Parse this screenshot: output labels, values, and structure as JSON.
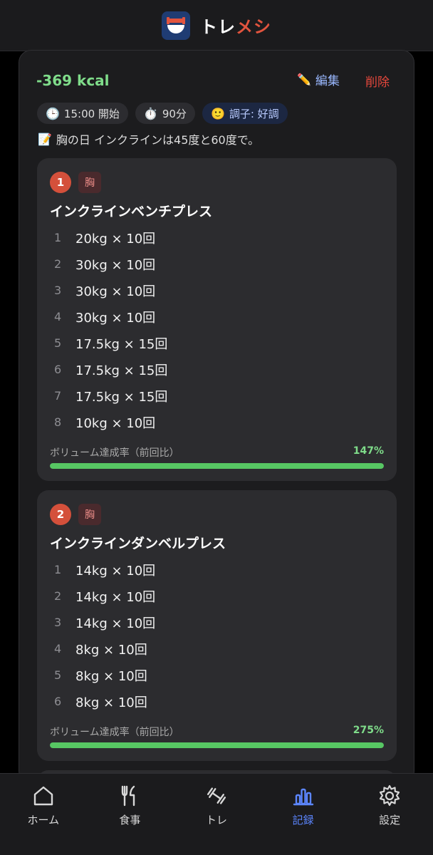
{
  "header": {
    "title_part1": "トレ",
    "title_part2": "メシ",
    "logo_icon": "dumbbell-bowl-icon"
  },
  "record": {
    "kcal": "-369 kcal",
    "edit_label": "編集",
    "delete_label": "削除",
    "chips": {
      "start": "15:00 開始",
      "duration": "90分",
      "condition": "調子: 好調"
    },
    "memo": "胸の日 インクラインは45度と60度で。"
  },
  "exercises": [
    {
      "index": "1",
      "part": "胸",
      "name": "インクラインベンチプレス",
      "sets": [
        {
          "no": "1",
          "value": "20kg × 10回"
        },
        {
          "no": "2",
          "value": "30kg × 10回"
        },
        {
          "no": "3",
          "value": "30kg × 10回"
        },
        {
          "no": "4",
          "value": "30kg × 10回"
        },
        {
          "no": "5",
          "value": "17.5kg × 15回"
        },
        {
          "no": "6",
          "value": "17.5kg × 15回"
        },
        {
          "no": "7",
          "value": "17.5kg × 15回"
        },
        {
          "no": "8",
          "value": "10kg × 10回"
        }
      ],
      "volume_label": "ボリューム達成率（前回比）",
      "volume_pct": "147%",
      "volume_fill": 1.0
    },
    {
      "index": "2",
      "part": "胸",
      "name": "インクラインダンベルプレス",
      "sets": [
        {
          "no": "1",
          "value": "14kg × 10回"
        },
        {
          "no": "2",
          "value": "14kg × 10回"
        },
        {
          "no": "3",
          "value": "14kg × 10回"
        },
        {
          "no": "4",
          "value": "8kg × 10回"
        },
        {
          "no": "5",
          "value": "8kg × 10回"
        },
        {
          "no": "6",
          "value": "8kg × 10回"
        }
      ],
      "volume_label": "ボリューム達成率（前回比）",
      "volume_pct": "275%",
      "volume_fill": 1.0
    }
  ],
  "nav": [
    {
      "label": "ホーム",
      "icon": "home-icon"
    },
    {
      "label": "食事",
      "icon": "fork-knife-icon"
    },
    {
      "label": "トレ",
      "icon": "dumbbell-icon"
    },
    {
      "label": "記録",
      "icon": "chart-icon",
      "active": true
    },
    {
      "label": "設定",
      "icon": "gear-icon"
    }
  ],
  "colors": {
    "accent": "#5c86ff",
    "kcal": "#7fdc8a",
    "delete": "#e5473c",
    "progress": "#57c763",
    "badge": "#d4503b"
  }
}
